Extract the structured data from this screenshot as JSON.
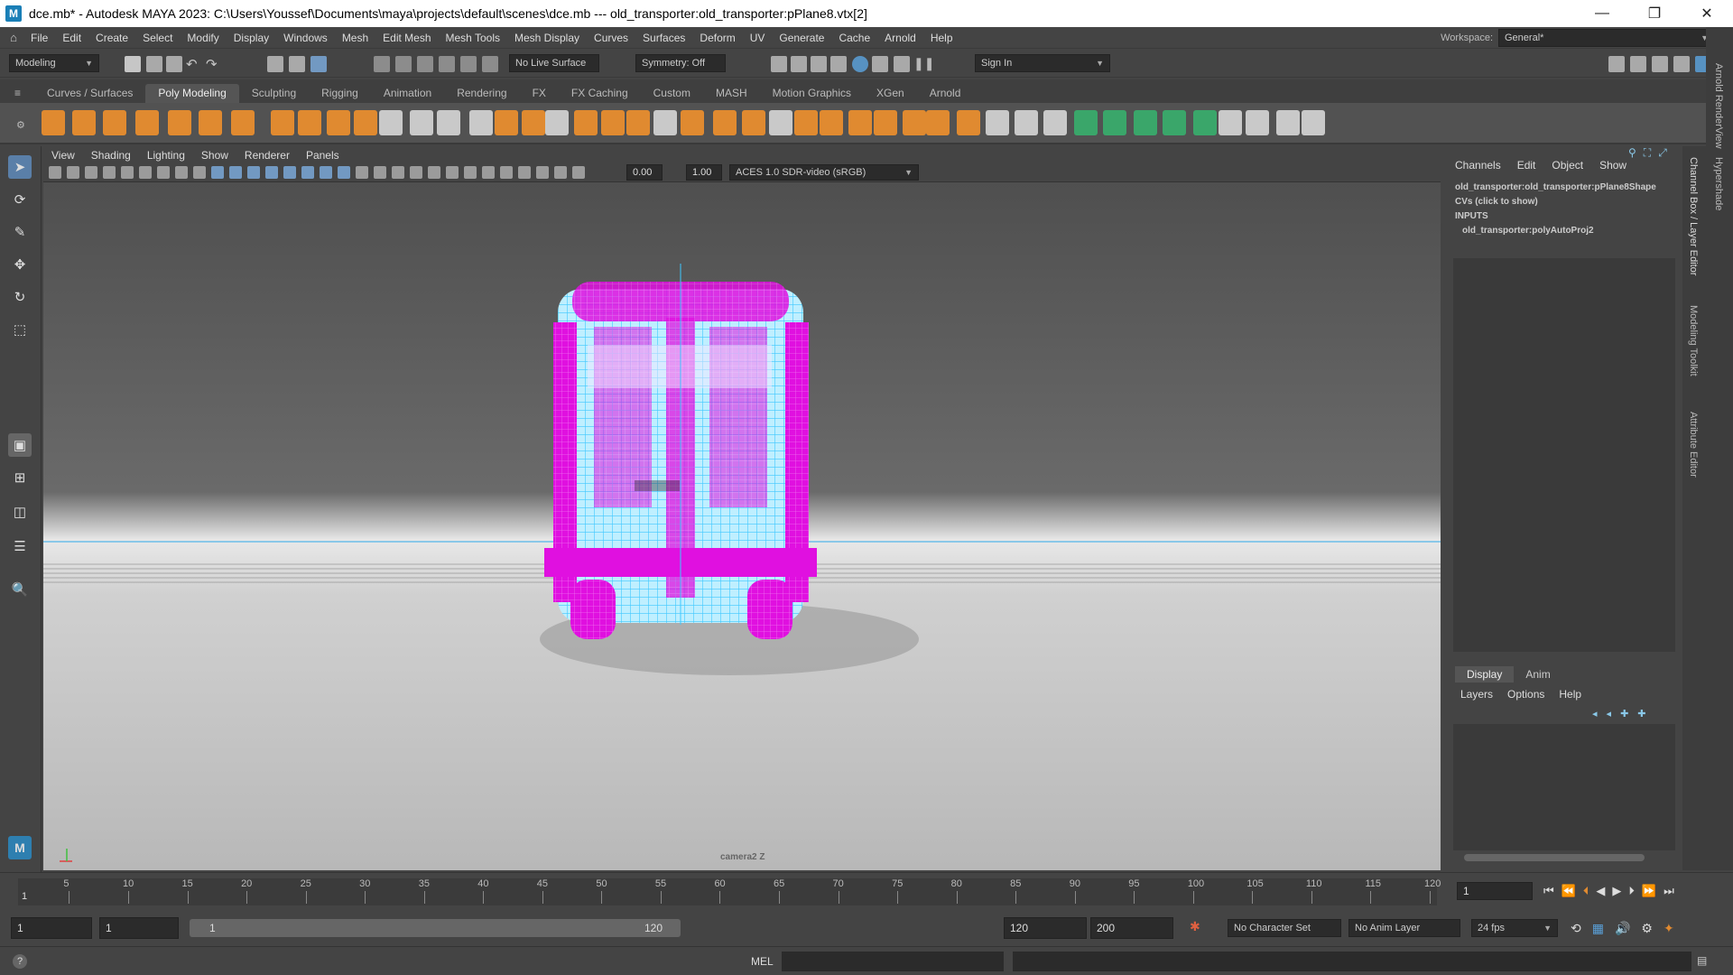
{
  "title": {
    "text": "dce.mb* - Autodesk MAYA 2023: C:\\Users\\Youssef\\Documents\\maya\\projects\\default\\scenes\\dce.mb   ---   old_transporter:old_transporter:pPlane8.vtx[2]"
  },
  "window_controls": {
    "minimize": "—",
    "restore": "❐",
    "close": "✕"
  },
  "menus": [
    "File",
    "Edit",
    "Create",
    "Select",
    "Modify",
    "Display",
    "Windows",
    "Mesh",
    "Edit Mesh",
    "Mesh Tools",
    "Mesh Display",
    "Curves",
    "Surfaces",
    "Deform",
    "UV",
    "Generate",
    "Cache",
    "Arnold",
    "Help"
  ],
  "workspace": {
    "label": "Workspace:",
    "value": "General*"
  },
  "status": {
    "mode": "Modeling",
    "live_surface": "No Live Surface",
    "symmetry": "Symmetry: Off",
    "sign_in": "Sign In"
  },
  "shelf_tabs": [
    "Curves / Surfaces",
    "Poly Modeling",
    "Sculpting",
    "Rigging",
    "Animation",
    "Rendering",
    "FX",
    "FX Caching",
    "Custom",
    "MASH",
    "Motion Graphics",
    "XGen",
    "Arnold"
  ],
  "shelf_active": "Poly Modeling",
  "viewport_menu": [
    "View",
    "Shading",
    "Lighting",
    "Show",
    "Renderer",
    "Panels"
  ],
  "viewport_fields": {
    "exposure": "0.00",
    "gamma": "1.00",
    "colorspace": "ACES 1.0 SDR-video (sRGB)"
  },
  "camera_label": "camera2 Z",
  "channel_box": {
    "tabs": [
      "Channels",
      "Edit",
      "Object",
      "Show"
    ],
    "object": "old_transporter:old_transporter:pPlane8Shape",
    "cvs": "CVs (click to show)",
    "inputs": "INPUTS",
    "input_node": "old_transporter:polyAutoProj2"
  },
  "layer_editor": {
    "tabs": [
      "Display",
      "Anim"
    ],
    "menu": [
      "Layers",
      "Options",
      "Help"
    ]
  },
  "side_tabs": [
    "Channel Box / Layer Editor",
    "Modeling Toolkit",
    "Attribute Editor"
  ],
  "far_side_tabs": [
    "Arnold RenderView",
    "Hypershade"
  ],
  "timeline": {
    "ticks": [
      "5",
      "10",
      "15",
      "20",
      "25",
      "30",
      "35",
      "40",
      "45",
      "50",
      "55",
      "60",
      "65",
      "70",
      "75",
      "80",
      "85",
      "90",
      "95",
      "100",
      "105",
      "110",
      "115",
      "120"
    ],
    "first_tick": "1",
    "current_frame": "1"
  },
  "range": {
    "start": "1",
    "playback_start": "1",
    "range_start": "1",
    "range_end": "120",
    "playback_end": "120",
    "end": "200",
    "character_set": "No Character Set",
    "anim_layer": "No Anim Layer",
    "fps": "24 fps"
  },
  "command": {
    "lang": "MEL",
    "help": "?"
  },
  "colors": {
    "accent": "#5aa0d8",
    "shelf_orange": "#e08a30",
    "wire_magenta": "#e010e0",
    "wire_cyan": "#58e0ff"
  }
}
